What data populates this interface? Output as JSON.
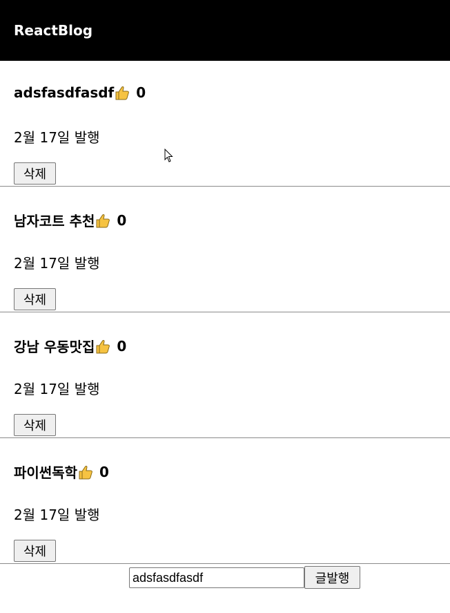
{
  "nav": {
    "title": "ReactBlog"
  },
  "posts": [
    {
      "title": "adsfasdfasdf",
      "likes": "0",
      "date": "2월 17일 발행",
      "delete_label": "삭제"
    },
    {
      "title": "남자코트 추천",
      "likes": "0",
      "date": "2월 17일 발행",
      "delete_label": "삭제"
    },
    {
      "title": "강남 우동맛집",
      "likes": "0",
      "date": "2월 17일 발행",
      "delete_label": "삭제"
    },
    {
      "title": "파이썬독학",
      "likes": "0",
      "date": "2월 17일 발행",
      "delete_label": "삭제"
    }
  ],
  "composer": {
    "input_value": "adsfasdfasdf",
    "submit_label": "글발행"
  },
  "icons": {
    "like": "thumbs-up-icon",
    "cursor": "mouse-pointer-icon"
  },
  "colors": {
    "nav_bg": "#000000",
    "nav_text": "#ffffff",
    "thumb": "#f6c342",
    "divider": "#8a8a8a"
  }
}
